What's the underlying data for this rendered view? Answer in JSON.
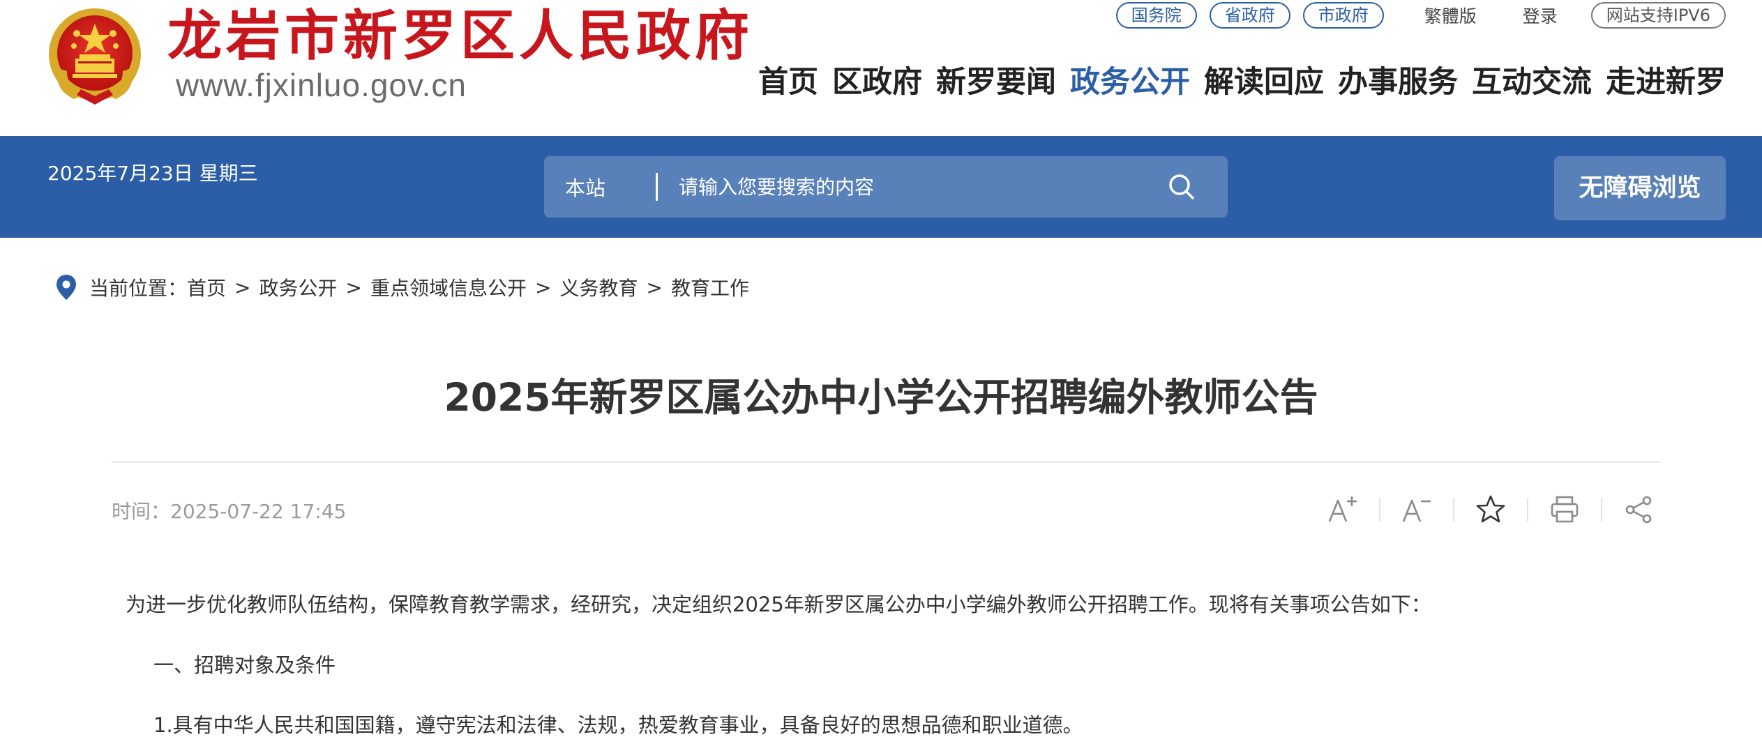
{
  "header": {
    "site_name": "龙岩市新罗区人民政府",
    "site_url": "www.fjxinluo.gov.cn",
    "emblem_icon": "national-emblem-icon",
    "top_links": [
      {
        "label": "国务院"
      },
      {
        "label": "省政府"
      },
      {
        "label": "市政府"
      }
    ],
    "traditional_label": "繁體版",
    "login_label": "登录",
    "ipv6_label": "网站支持IPV6",
    "nav": [
      {
        "label": "首页"
      },
      {
        "label": "区政府"
      },
      {
        "label": "新罗要闻"
      },
      {
        "label": "政务公开",
        "active": true
      },
      {
        "label": "解读回应"
      },
      {
        "label": "办事服务"
      },
      {
        "label": "互动交流"
      },
      {
        "label": "走进新罗"
      }
    ]
  },
  "bar": {
    "date": "2025年7月23日 星期三",
    "search_scope": "本站",
    "search_placeholder": "请输入您要搜索的内容",
    "search_icon": "search-icon",
    "accessibility_label": "无障碍浏览"
  },
  "breadcrumb": {
    "prefix": "当前位置：",
    "items": [
      "首页",
      "政务公开",
      "重点领域信息公开",
      "义务教育",
      "教育工作"
    ],
    "separator": ">"
  },
  "article": {
    "title": "2025年新罗区属公办中小学公开招聘编外教师公告",
    "time_label": "时间：",
    "time_value": "2025-07-22 17:45",
    "tools": [
      "font-increase-icon",
      "font-decrease-icon",
      "star-icon",
      "print-icon",
      "share-icon"
    ],
    "paragraphs": [
      "为进一步优化教师队伍结构，保障教育教学需求，经研究，决定组织2025年新罗区属公办中小学编外教师公开招聘工作。现将有关事项公告如下：",
      "一、招聘对象及条件",
      "1.具有中华人民共和国国籍，遵守宪法和法律、法规，热爱教育事业，具备良好的思想品德和职业道德。"
    ]
  },
  "colors": {
    "brand_red": "#c8161d",
    "brand_blue": "#2b5ea6",
    "text": "#333333",
    "muted": "#9a9a9a"
  }
}
